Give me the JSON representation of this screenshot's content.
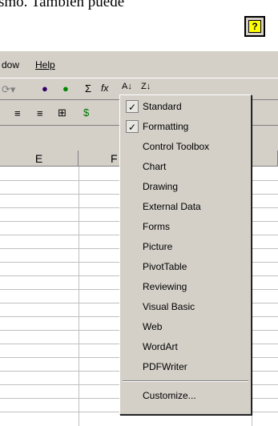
{
  "doc": {
    "text": "smo. También puede"
  },
  "menubar": {
    "items": [
      "dow",
      "Help"
    ]
  },
  "sheet": {
    "columns": [
      "E",
      "F"
    ]
  },
  "toolbar_menu": {
    "items": [
      {
        "label": "Standard",
        "checked": true
      },
      {
        "label": "Formatting",
        "checked": true
      },
      {
        "label": "Control Toolbox",
        "checked": false
      },
      {
        "label": "Chart",
        "checked": false
      },
      {
        "label": "Drawing",
        "checked": false
      },
      {
        "label": "External Data",
        "checked": false
      },
      {
        "label": "Forms",
        "checked": false
      },
      {
        "label": "Picture",
        "checked": false
      },
      {
        "label": "PivotTable",
        "checked": false
      },
      {
        "label": "Reviewing",
        "checked": false
      },
      {
        "label": "Visual Basic",
        "checked": false
      },
      {
        "label": "Web",
        "checked": false
      },
      {
        "label": "WordArt",
        "checked": false
      },
      {
        "label": "PDFWriter",
        "checked": false
      }
    ],
    "customize": "Customize..."
  },
  "icons": {
    "help": "help-question-icon",
    "check": "checkmark-icon"
  },
  "toolbar_glyphs": {
    "sigma": "Σ",
    "fx": "fx",
    "check": "✓",
    "help": "?"
  }
}
